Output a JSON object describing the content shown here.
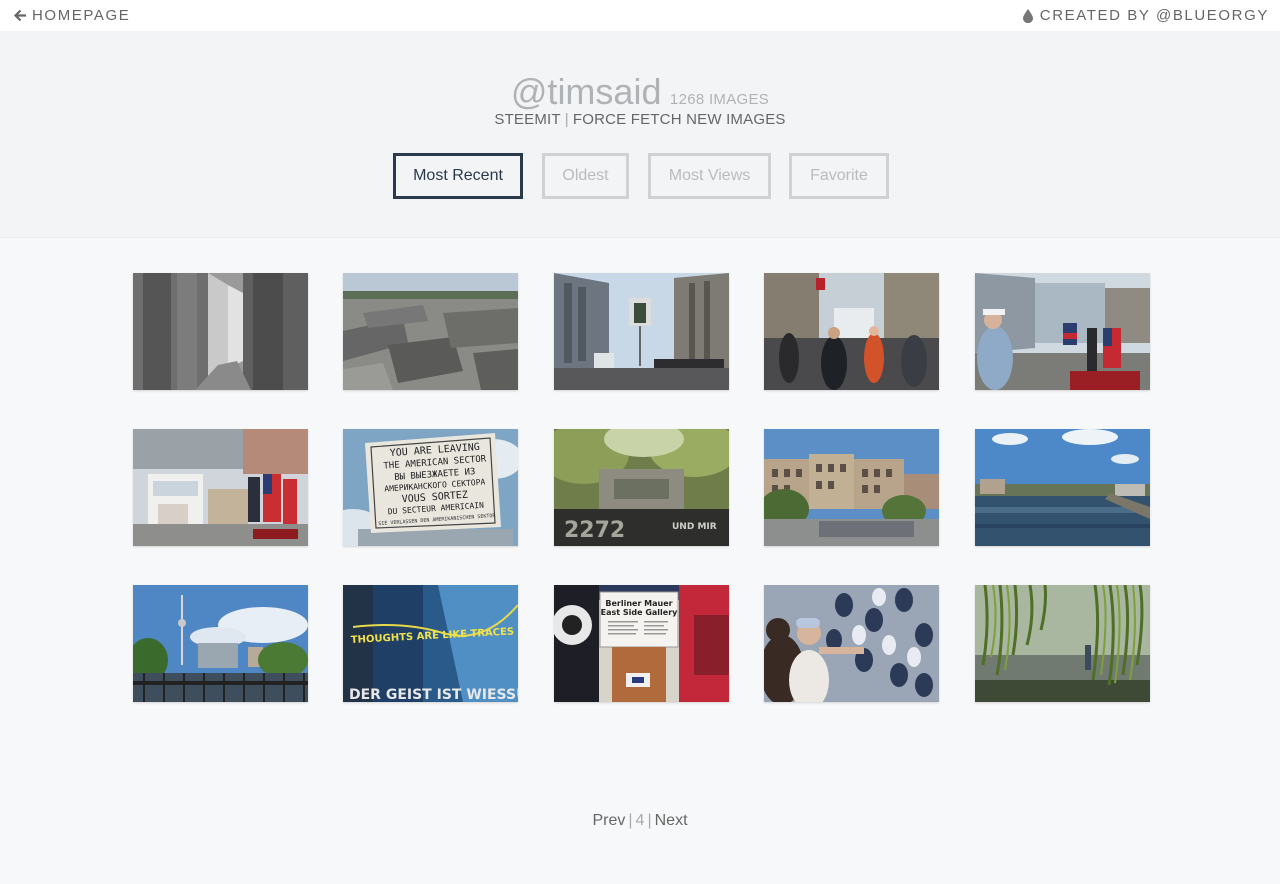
{
  "nav": {
    "home_label": "HOMEPAGE",
    "credit_label": "CREATED BY @BLUEORGY"
  },
  "profile": {
    "username": "@timsaid",
    "image_count": "1268 IMAGES",
    "steemit_label": "STEEMIT",
    "separator": "|",
    "force_fetch_label": "FORCE FETCH NEW IMAGES"
  },
  "sort_buttons": [
    {
      "label": "Most Recent",
      "active": true
    },
    {
      "label": "Oldest",
      "active": false
    },
    {
      "label": "Most Views",
      "active": false
    },
    {
      "label": "Favorite",
      "active": false
    }
  ],
  "gallery": {
    "thumbnails": [
      {
        "subject": "memorial-corridor"
      },
      {
        "subject": "memorial-field"
      },
      {
        "subject": "street-checkpoint"
      },
      {
        "subject": "crowd-flags"
      },
      {
        "subject": "soldier-flags"
      },
      {
        "subject": "guard-house"
      },
      {
        "subject": "sector-sign",
        "sign_text": [
          "YOU ARE LEAVING",
          "THE AMERICAN SECTOR",
          "ВЫ ВЫЕЗЖАЕТЕ ИЗ",
          "АМЕРИКАНСКОГО СЕКТОРА",
          "VOUS SORTEZ",
          "DU SECTEUR AMERICAIN",
          "SIE VERLASSEN DEN AMERIKANISCHEN SEKTOR"
        ]
      },
      {
        "subject": "forest-graffiti"
      },
      {
        "subject": "old-building"
      },
      {
        "subject": "river-view"
      },
      {
        "subject": "tv-tower-bridge"
      },
      {
        "subject": "wall-mural-thoughts",
        "mural_text": [
          "THOUGHTS ARE LIKE TRACES OF",
          "DER GEIST IST WIESSU"
        ]
      },
      {
        "subject": "east-side-gallery-sign",
        "sign_text": [
          "Berliner Mauer",
          "East Side Gallery"
        ]
      },
      {
        "subject": "hands-mural"
      },
      {
        "subject": "willow-river"
      }
    ]
  },
  "pagination": {
    "prev_label": "Prev",
    "current_page": "4",
    "next_label": "Next",
    "separator": "|"
  },
  "colors": {
    "accent_dark": "#2a3a4c",
    "inactive_border": "#cfd2d5",
    "muted_text": "#b0b3b6",
    "background": "#f7f8f9"
  }
}
